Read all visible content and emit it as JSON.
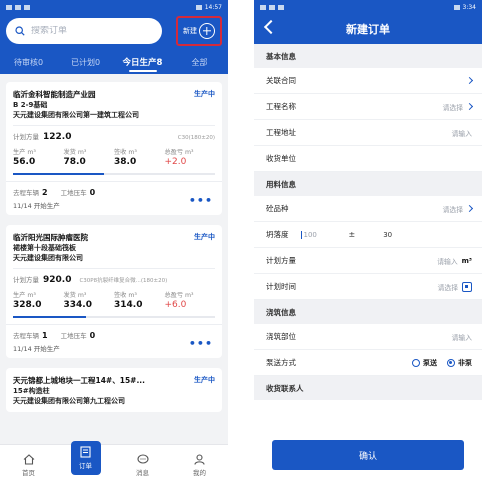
{
  "colors": {
    "primary": "#1a57c4",
    "highlight": "#d42a3a",
    "negative": "#e04848"
  },
  "order_list": {
    "status_time": "14:57",
    "search": {
      "placeholder": "搜索订单"
    },
    "new_label": "新建",
    "tabs": [
      {
        "label": "待审核0"
      },
      {
        "label": "已计划0"
      },
      {
        "label": "今日生产8",
        "active": true
      },
      {
        "label": "全部"
      }
    ],
    "cards": [
      {
        "project": "临沂金科智能制造产业园",
        "part": "B 2-9基础",
        "company": "天元建设集团有限公司第一建筑工程公司",
        "status": "生产中",
        "plan_label": "计划方量",
        "plan_value": "122.0",
        "spec": "C30(180±20)",
        "stats": [
          {
            "label": "生产 m³",
            "value": "56.0"
          },
          {
            "label": "发货 m³",
            "value": "78.0"
          },
          {
            "label": "签收 m³",
            "value": "38.0"
          },
          {
            "label": "总盈亏 m³",
            "value": "+2.0"
          }
        ],
        "progress": 0.45,
        "trips_label": "去程车辆",
        "trips": "2",
        "site_label": "工地压车",
        "site": "0",
        "date": "11/14  开始生产"
      },
      {
        "project": "临沂阳光国际肿瘤医院",
        "part": "裙楼第十段基础筏板",
        "company": "天元建设集团有限公司",
        "status": "生产中",
        "plan_label": "计划方量",
        "plan_value": "920.0",
        "spec": "C30P8抗裂纤维复合微...(180±20)",
        "stats": [
          {
            "label": "生产 m³",
            "value": "328.0"
          },
          {
            "label": "发货 m³",
            "value": "334.0"
          },
          {
            "label": "签收 m³",
            "value": "314.0"
          },
          {
            "label": "总盈亏 m³",
            "value": "+6.0"
          }
        ],
        "progress": 0.36,
        "trips_label": "去程车辆",
        "trips": "1",
        "site_label": "工地压车",
        "site": "0",
        "date": "11/14  开始生产"
      },
      {
        "project": "天元锦都上城地块一工程14#、15#...",
        "part": "15#构造柱",
        "company": "天元建设集团有限公司第九工程公司",
        "status": "生产中"
      }
    ],
    "tabbar": [
      {
        "label": "首页",
        "icon": "home-icon"
      },
      {
        "label": "订单",
        "icon": "order-icon",
        "active": true
      },
      {
        "label": "消息",
        "icon": "message-icon"
      },
      {
        "label": "我的",
        "icon": "user-icon"
      }
    ]
  },
  "new_order": {
    "status_time": "3:34",
    "title": "新建订单",
    "sections": {
      "basic": "基本信息",
      "material": "用料信息",
      "pour": "浇筑信息",
      "receiver": "收货联系人"
    },
    "rows": {
      "contract": {
        "label": "关联合同"
      },
      "project_name": {
        "label": "工程名称",
        "value": "请选择"
      },
      "project_addr": {
        "label": "工程地址",
        "value": "请输入"
      },
      "receiver_unit": {
        "label": "收货单位"
      },
      "concrete_type": {
        "label": "砼品种",
        "value": "请选择"
      },
      "slump": {
        "label": "坍落度",
        "value1": "100",
        "pm": "±",
        "value2": "30"
      },
      "plan_volume": {
        "label": "计划方量",
        "value": "请输入",
        "unit": "m³"
      },
      "plan_time": {
        "label": "计划时间",
        "value": "请选择"
      },
      "pour_part": {
        "label": "浇筑部位",
        "value": "请输入"
      },
      "pump": {
        "label": "泵送方式",
        "option1": "泵送",
        "option2": "非泵"
      }
    },
    "confirm_label": "确认"
  }
}
